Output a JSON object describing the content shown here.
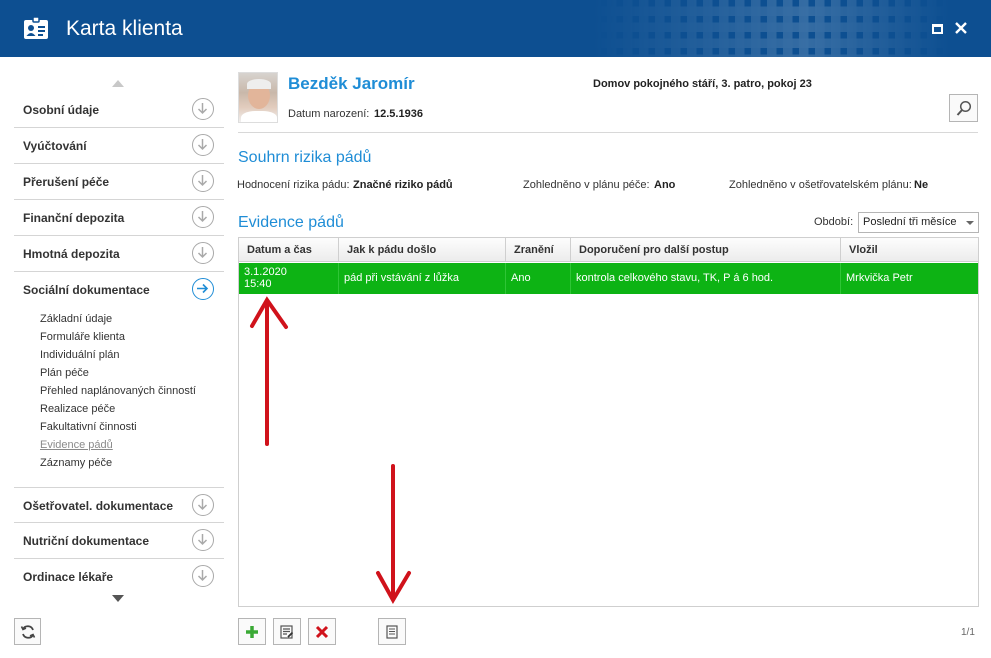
{
  "window": {
    "title": "Karta klienta"
  },
  "sidebar": {
    "items": [
      {
        "label": "Osobní údaje",
        "active": false
      },
      {
        "label": "Vyúčtování",
        "active": false
      },
      {
        "label": "Přerušení péče",
        "active": false
      },
      {
        "label": "Finanční depozita",
        "active": false
      },
      {
        "label": "Hmotná depozita",
        "active": false
      },
      {
        "label": "Sociální dokumentace",
        "active": true
      },
      {
        "label": "Ošetřovatel. dokumentace",
        "active": false
      },
      {
        "label": "Nutriční dokumentace",
        "active": false
      },
      {
        "label": "Ordinace lékaře",
        "active": false
      }
    ],
    "subitems": [
      "Základní údaje",
      "Formuláře klienta",
      "Individuální plán",
      "Plán péče",
      "Přehled naplánovaných činností",
      "Realizace péče",
      "Fakultativní činnosti",
      "Evidence pádů",
      "Záznamy péče"
    ],
    "current_subitem": "Evidence pádů"
  },
  "client": {
    "name": "Bezděk Jaromír",
    "dob_label": "Datum narození:",
    "dob": "12.5.1936",
    "location": "Domov pokojného stáří, 3. patro, pokoj 23"
  },
  "risk": {
    "title": "Souhrn rizika pádů",
    "assessment_label": "Hodnocení rizika pádu:",
    "assessment_value": "Značné riziko pádů",
    "care_plan_label": "Zohledněno v plánu péče:",
    "care_plan_value": "Ano",
    "nursing_plan_label": "Zohledněno v ošetřovatelském plánu:",
    "nursing_plan_value": "Ne"
  },
  "falls": {
    "title": "Evidence pádů",
    "period_label": "Období:",
    "period_value": "Poslední tři měsíce",
    "columns": [
      "Datum a čas",
      "Jak k pádu došlo",
      "Zranění",
      "Doporučení pro další postup",
      "Vložil"
    ],
    "rows": [
      {
        "date": "3.1.2020",
        "time": "15:40",
        "how": "pád při vstávání z lůžka",
        "injury": "Ano",
        "recommendation": "kontrola celkového stavu, TK, P á 6 hod.",
        "author": "Mrkvička Petr"
      }
    ],
    "selected_row_color": "#0db314",
    "pager": "1/1"
  },
  "colors": {
    "titlebar": "#0d4f91",
    "accent": "#1f8dd6",
    "annotation_arrow": "#d0121b",
    "add_icon": "#3aa935",
    "delete_icon": "#d0121b"
  },
  "icons": {
    "app": "client-card-icon",
    "search": "magnifier-icon",
    "refresh": "refresh-icon",
    "add": "plus-icon",
    "edit": "edit-document-icon",
    "delete": "cross-icon",
    "detail": "document-icon"
  }
}
